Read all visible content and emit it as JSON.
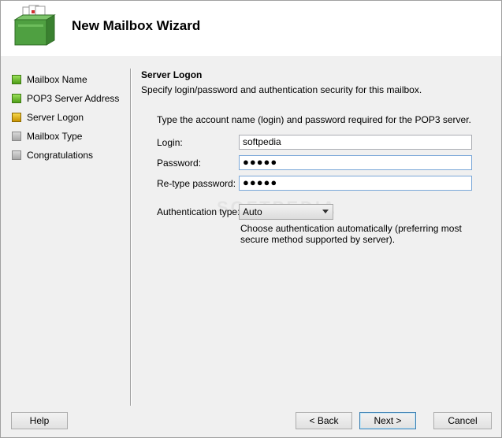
{
  "wizard": {
    "title": "New Mailbox Wizard"
  },
  "steps": [
    {
      "label": "Mailbox Name",
      "state": "done"
    },
    {
      "label": "POP3 Server Address",
      "state": "done"
    },
    {
      "label": "Server Logon",
      "state": "current"
    },
    {
      "label": "Mailbox Type",
      "state": "todo"
    },
    {
      "label": "Congratulations",
      "state": "todo"
    }
  ],
  "section": {
    "title": "Server Logon",
    "description": "Specify login/password and authentication security for this mailbox.",
    "instructions": "Type the account name (login) and password required for the POP3 server."
  },
  "form": {
    "login_label": "Login:",
    "login_value": "softpedia",
    "password_label": "Password:",
    "password_value": "●●●●●",
    "retype_label": "Re-type password:",
    "retype_value": "●●●●●",
    "auth_label": "Authentication type:",
    "auth_value": "Auto",
    "auth_description": "Choose authentication automatically (preferring most secure method supported by server)."
  },
  "watermark": "SOFTPEDIA",
  "buttons": {
    "help": "Help",
    "back": "< Back",
    "next": "Next >",
    "cancel": "Cancel"
  },
  "colors": {
    "done": "#4e9e17",
    "current": "#c79100",
    "todo": "#a8a8a8"
  }
}
